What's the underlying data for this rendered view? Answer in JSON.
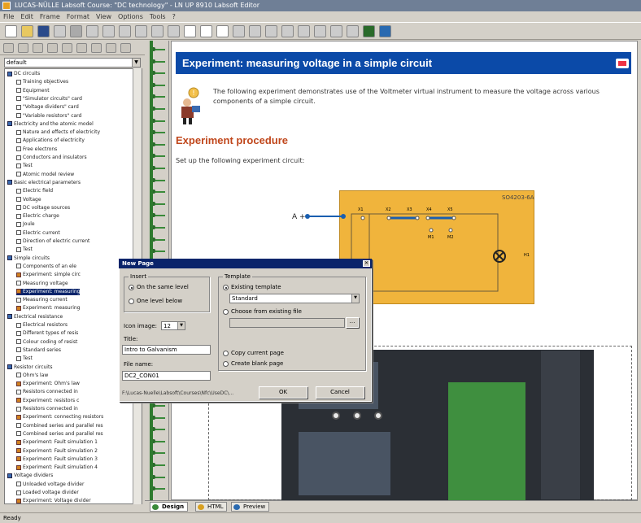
{
  "window": {
    "title": "LUCAS-NÜLLE Labsoft Course: \"DC technology\" - LN UP 8910 Labsoft Editor"
  },
  "menu": [
    "File",
    "Edit",
    "Frame",
    "Format",
    "View",
    "Options",
    "Tools",
    "?"
  ],
  "toolbar": {
    "icons": [
      "new-icon",
      "open-icon",
      "save-icon",
      "print-icon",
      "cut-icon",
      "copy-icon",
      "paste-icon",
      "undo-icon",
      "redo-icon",
      "sum-icon",
      "link-icon",
      "bold-icon",
      "italic-icon",
      "underline-icon",
      "align-left-icon",
      "align-center-icon",
      "align-right-icon",
      "bullets-icon",
      "numbering-icon",
      "indent-icon",
      "outdent-icon",
      "image-icon",
      "anchor-icon",
      "check-icon"
    ]
  },
  "sidebar": {
    "combo_value": "default",
    "tree": [
      {
        "level": 0,
        "label": "DC circuits",
        "icon": "book"
      },
      {
        "level": 1,
        "label": "Training objectives",
        "icon": "page"
      },
      {
        "level": 1,
        "label": "Equipment",
        "icon": "page"
      },
      {
        "level": 1,
        "label": "\"Simulator circuits\" card",
        "icon": "page"
      },
      {
        "level": 1,
        "label": "\"Voltage dividers\" card",
        "icon": "page"
      },
      {
        "level": 1,
        "label": "\"Variable resistors\" card",
        "icon": "page"
      },
      {
        "level": 0,
        "label": "Electricity and the atomic model",
        "icon": "book"
      },
      {
        "level": 1,
        "label": "Nature and effects of electricity",
        "icon": "page"
      },
      {
        "level": 1,
        "label": "Applications of electricity",
        "icon": "page"
      },
      {
        "level": 1,
        "label": "Free electrons",
        "icon": "page"
      },
      {
        "level": 1,
        "label": "Conductors and insulators",
        "icon": "page"
      },
      {
        "level": 1,
        "label": "Test",
        "icon": "page"
      },
      {
        "level": 1,
        "label": "Atomic model review",
        "icon": "page"
      },
      {
        "level": 0,
        "label": "Basic electrical parameters",
        "icon": "book"
      },
      {
        "level": 1,
        "label": "Electric field",
        "icon": "page"
      },
      {
        "level": 1,
        "label": "Voltage",
        "icon": "page"
      },
      {
        "level": 1,
        "label": "DC voltage sources",
        "icon": "page"
      },
      {
        "level": 1,
        "label": "Electric charge",
        "icon": "page"
      },
      {
        "level": 1,
        "label": "Joule",
        "icon": "page"
      },
      {
        "level": 1,
        "label": "Electric current",
        "icon": "page"
      },
      {
        "level": 1,
        "label": "Direction of electric current",
        "icon": "page"
      },
      {
        "level": 1,
        "label": "Test",
        "icon": "page"
      },
      {
        "level": 0,
        "label": "Simple circuits",
        "icon": "book"
      },
      {
        "level": 1,
        "label": "Components of an ele",
        "icon": "page"
      },
      {
        "level": 1,
        "label": "Experiment: simple circ",
        "icon": "exp"
      },
      {
        "level": 1,
        "label": "Measuring voltage",
        "icon": "page"
      },
      {
        "level": 1,
        "label": "Experiment: measuring",
        "icon": "exp",
        "selected": true
      },
      {
        "level": 1,
        "label": "Measuring current",
        "icon": "page"
      },
      {
        "level": 1,
        "label": "Experiment: measuring",
        "icon": "exp"
      },
      {
        "level": 0,
        "label": "Electrical resistance",
        "icon": "book"
      },
      {
        "level": 1,
        "label": "Electrical resistors",
        "icon": "page"
      },
      {
        "level": 1,
        "label": "Different types of resis",
        "icon": "page"
      },
      {
        "level": 1,
        "label": "Colour coding of resist",
        "icon": "page"
      },
      {
        "level": 1,
        "label": "Standard series",
        "icon": "page"
      },
      {
        "level": 1,
        "label": "Test",
        "icon": "page"
      },
      {
        "level": 0,
        "label": "Resistor circuits",
        "icon": "book"
      },
      {
        "level": 1,
        "label": "Ohm's law",
        "icon": "page"
      },
      {
        "level": 1,
        "label": "Experiment: Ohm's law",
        "icon": "exp"
      },
      {
        "level": 1,
        "label": "Resistors connected in",
        "icon": "page"
      },
      {
        "level": 1,
        "label": "Experiment: resistors c",
        "icon": "exp"
      },
      {
        "level": 1,
        "label": "Resistors connected in",
        "icon": "page"
      },
      {
        "level": 1,
        "label": "Experiment: connecting resistors",
        "icon": "exp"
      },
      {
        "level": 1,
        "label": "Combined series and parallel res",
        "icon": "page"
      },
      {
        "level": 1,
        "label": "Combined series and parallel res",
        "icon": "page"
      },
      {
        "level": 1,
        "label": "Experiment: Fault simulation 1",
        "icon": "exp"
      },
      {
        "level": 1,
        "label": "Experiment: Fault simulation 2",
        "icon": "exp"
      },
      {
        "level": 1,
        "label": "Experiment: Fault simulation 3",
        "icon": "exp"
      },
      {
        "level": 1,
        "label": "Experiment: Fault simulation 4",
        "icon": "exp"
      },
      {
        "level": 0,
        "label": "Voltage dividers",
        "icon": "book"
      },
      {
        "level": 1,
        "label": "Unloaded voltage divider",
        "icon": "page"
      },
      {
        "level": 1,
        "label": "Loaded voltage divider",
        "icon": "page"
      },
      {
        "level": 1,
        "label": "Experiment: Voltage divider",
        "icon": "exp"
      }
    ]
  },
  "page": {
    "header_title": "Experiment: measuring voltage in a simple circuit",
    "intro_text": "The following experiment demonstrates use of the Voltmeter virtual instrument to measure the voltage across various components of a simple circuit.",
    "procedure_title": "Experiment procedure",
    "setup_text": "Set up the following experiment circuit:",
    "board_id": "SO4203-6A",
    "terminal_label": "A",
    "terminal_labels": [
      "X1",
      "X2",
      "X3",
      "X4",
      "X5"
    ],
    "node_labels": [
      "M1",
      "M2"
    ],
    "lamp_label": "H1"
  },
  "dialog": {
    "title": "New Page",
    "insert_group": "Insert",
    "radio_same_level": "On the same level",
    "radio_one_level": "One level below",
    "icon_image_label": "Icon image:",
    "icon_image_value": "12",
    "title_label": "Title:",
    "title_value": "Intro to Galvanism",
    "filename_label": "File name:",
    "filename_value": "DC2_CON01",
    "path_text": "F:\\Lucas-Nuelle\\Labsoft\\Courses\\Nfc\\UseDC\\...",
    "template_group": "Template",
    "existing_template_label": "Existing template",
    "template_value": "Standard",
    "choose_existing_label": "Choose from existing file",
    "copy_current_label": "Copy current page",
    "create_blank_label": "Create blank page",
    "ok_label": "OK",
    "cancel_label": "Cancel"
  },
  "tabs": [
    {
      "label": "Design",
      "active": true,
      "color": "#3a8a3a"
    },
    {
      "label": "HTML",
      "active": false,
      "color": "#d8a020"
    },
    {
      "label": "Preview",
      "active": false,
      "color": "#2a6ab0"
    }
  ],
  "status": {
    "text": "Ready"
  }
}
